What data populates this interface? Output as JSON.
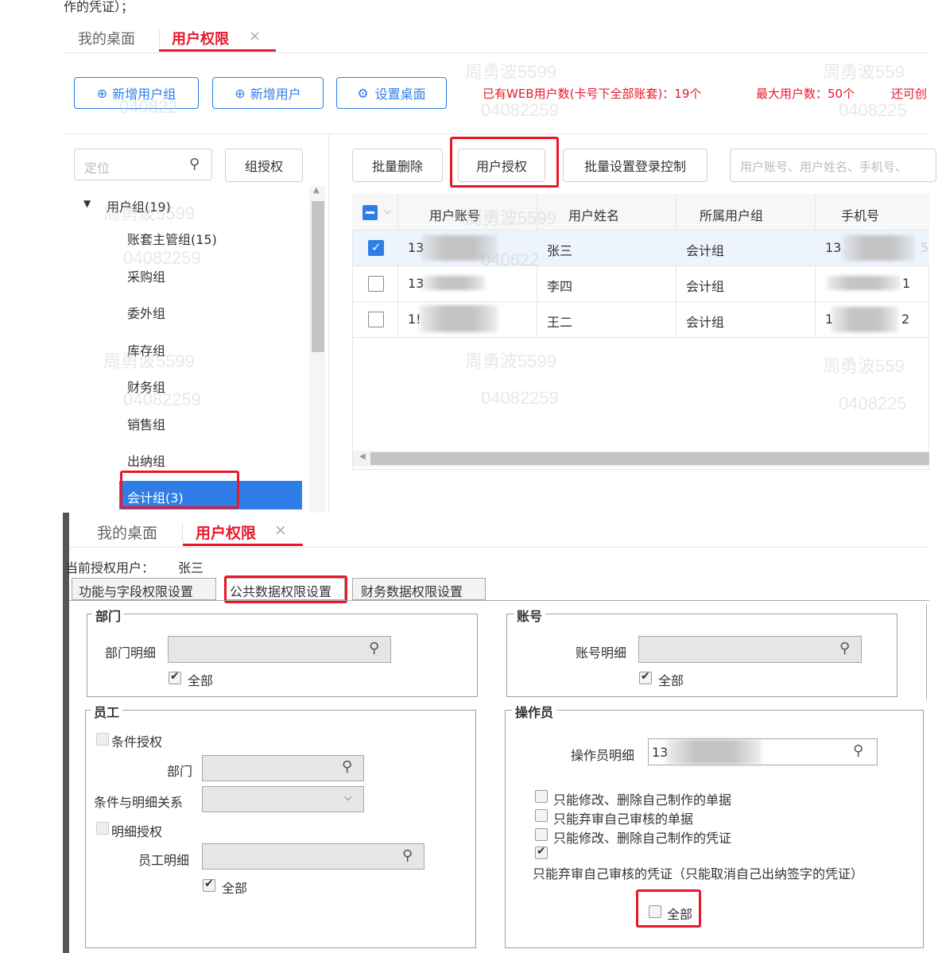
{
  "top_fragment": "作的凭证）；",
  "tabs": {
    "desk": "我的桌面",
    "perm": "用户权限",
    "close": "×"
  },
  "toolbar": {
    "add_group": "新增用户组",
    "add_user": "新增用户",
    "set_desk": "设置桌面",
    "web_users_label": "已有WEB用户数(卡号下全部账套)：19个",
    "max_users_label": "最大用户数：50个",
    "remain_label": "还可创"
  },
  "left": {
    "locate_placeholder": "定位",
    "group_auth": "组授权",
    "tree_root": "用户组(19)",
    "groups": [
      "账套主管组(15)",
      "采购组",
      "委外组",
      "库存组",
      "财务组",
      "销售组",
      "出纳组",
      "会计组(3)"
    ]
  },
  "actions": {
    "batch_delete": "批量删除",
    "user_auth": "用户授权",
    "batch_login": "批量设置登录控制",
    "search_placeholder": "用户账号、用户姓名、手机号、"
  },
  "table": {
    "headers": [
      "用户账号",
      "用户姓名",
      "所属用户组",
      "手机号"
    ],
    "rows": [
      {
        "account": "13",
        "name": "张三",
        "group": "会计组",
        "phone": "13",
        "phone_tail": "5",
        "checked": true
      },
      {
        "account": "13",
        "name": "李四",
        "group": "会计组",
        "phone": "",
        "phone_tail": "1",
        "checked": false
      },
      {
        "account": "1!",
        "name": "王二",
        "group": "会计组",
        "phone": "1",
        "phone_tail": "2",
        "checked": false
      }
    ]
  },
  "watermark": {
    "name_a": "周勇波5599",
    "name_b": "周勇波559",
    "num_a": "04082259",
    "num_b": "0408225",
    "num_c": "040822"
  },
  "dialog": {
    "current_user_label": "当前授权用户：",
    "current_user": "张三",
    "subtabs": [
      "功能与字段权限设置",
      "公共数据权限设置",
      "财务数据权限设置"
    ],
    "dept": {
      "title": "部门",
      "detail_label": "部门明细",
      "all": "全部"
    },
    "account": {
      "title": "账号",
      "detail_label": "账号明细",
      "all": "全部"
    },
    "employee": {
      "title": "员工",
      "cond_auth": "条件授权",
      "dept_label": "部门",
      "relation_label": "条件与明细关系",
      "detail_auth": "明细授权",
      "emp_detail_label": "员工明细",
      "all": "全部"
    },
    "operator": {
      "title": "操作员",
      "detail_label": "操作员明细",
      "detail_value": "13",
      "opt1": "只能修改、删除自己制作的单据",
      "opt2": "只能弃审自己审核的单据",
      "opt3": "只能修改、删除自己制作的凭证",
      "opt4": "只能弃审自己审核的凭证（只能取消自己出纳签字的凭证）",
      "all": "全部"
    }
  }
}
